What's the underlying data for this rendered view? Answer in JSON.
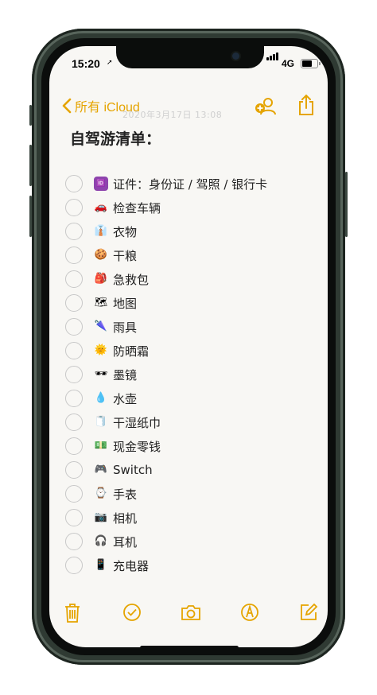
{
  "status_bar": {
    "time": "15:20",
    "network": "4G",
    "battery_level": 0.72
  },
  "nav": {
    "back_label": "所有 iCloud"
  },
  "header_hint": "2020年3月17日 13:08",
  "note": {
    "title": "自驾游清单：",
    "items": [
      {
        "icon": "id-badge-icon",
        "emoji": "🆔",
        "label": "证件：身份证 / 驾照 / 银行卡",
        "checked": false
      },
      {
        "icon": "car-icon",
        "emoji": "🚗",
        "label": "检查车辆",
        "checked": false
      },
      {
        "icon": "shirt-icon",
        "emoji": "👔",
        "label": "衣物",
        "checked": false
      },
      {
        "icon": "cookie-icon",
        "emoji": "🍪",
        "label": "干粮",
        "checked": false
      },
      {
        "icon": "backpack-icon",
        "emoji": "🎒",
        "label": "急救包",
        "checked": false
      },
      {
        "icon": "map-icon",
        "emoji": "🗺",
        "label": "地图",
        "checked": false
      },
      {
        "icon": "umbrella-icon",
        "emoji": "🌂",
        "label": "雨具",
        "checked": false
      },
      {
        "icon": "sun-face-icon",
        "emoji": "🌞",
        "label": "防晒霜",
        "checked": false
      },
      {
        "icon": "sunglasses-icon",
        "emoji": "🕶",
        "label": "墨镜",
        "checked": false
      },
      {
        "icon": "droplet-icon",
        "emoji": "💧",
        "label": "水壶",
        "checked": false
      },
      {
        "icon": "tissue-roll-icon",
        "emoji": "🧻",
        "label": "干湿纸巾",
        "checked": false
      },
      {
        "icon": "money-icon",
        "emoji": "💵",
        "label": "现金零钱",
        "checked": false
      },
      {
        "icon": "gamepad-icon",
        "emoji": "🎮",
        "label": "Switch",
        "checked": false
      },
      {
        "icon": "watch-icon",
        "emoji": "⌚",
        "label": "手表",
        "checked": false
      },
      {
        "icon": "camera-icon",
        "emoji": "📷",
        "label": "相机",
        "checked": false
      },
      {
        "icon": "headphones-icon",
        "emoji": "🎧",
        "label": "耳机",
        "checked": false
      },
      {
        "icon": "phone-icon",
        "emoji": "📱",
        "label": "充电器",
        "checked": false
      }
    ]
  },
  "toolbar": [
    "trash-icon",
    "checklist-icon",
    "camera-icon",
    "markup-icon",
    "compose-icon"
  ],
  "colors": {
    "accent": "#e5a400",
    "paper": "#f8f7f4",
    "frame": "#2f3a33",
    "text": "#222222"
  }
}
